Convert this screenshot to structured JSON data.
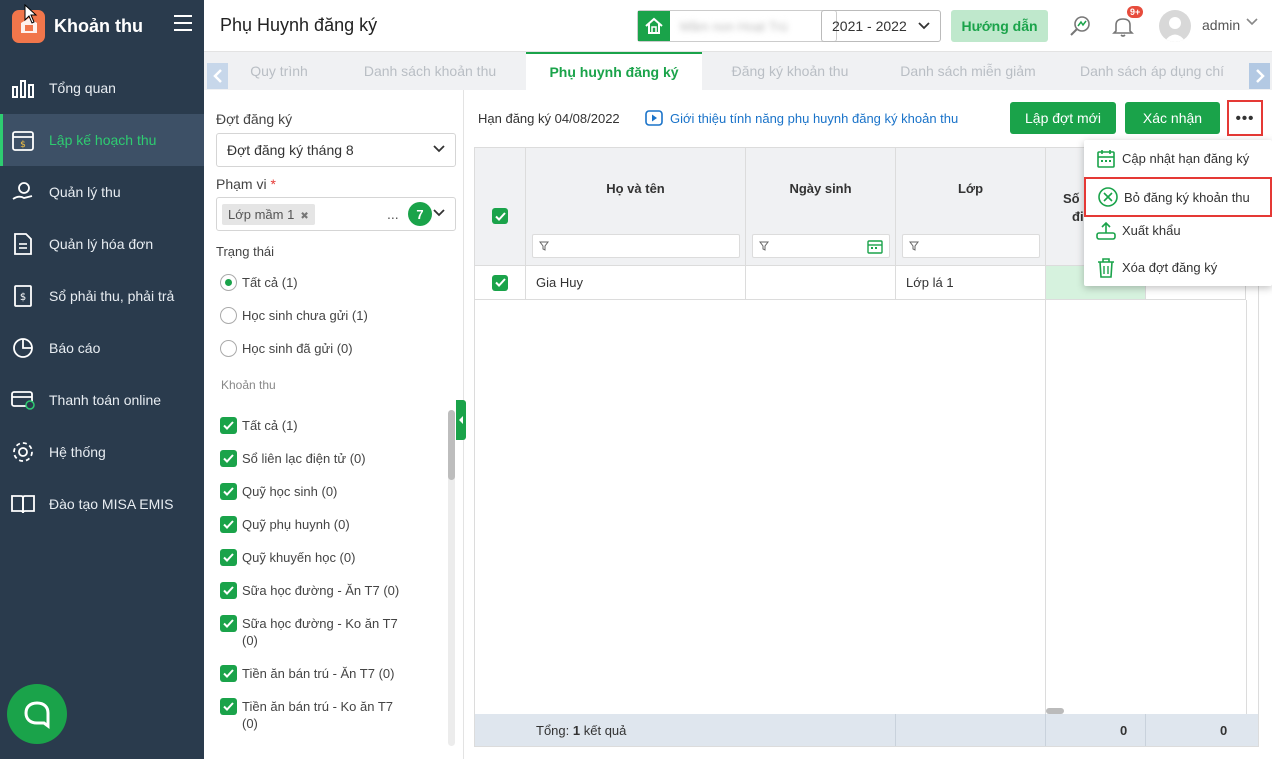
{
  "app": {
    "title": "Khoản thu"
  },
  "sidebar": {
    "items": [
      {
        "label": "Tổng quan",
        "icon": "bar-chart-icon"
      },
      {
        "label": "Lập kế hoạch thu",
        "icon": "calendar-dollar-icon",
        "active": true
      },
      {
        "label": "Quản lý thu",
        "icon": "hand-coin-icon"
      },
      {
        "label": "Quản lý hóa đơn",
        "icon": "invoice-icon"
      },
      {
        "label": "Sổ phải thu, phải trả",
        "icon": "ledger-icon"
      },
      {
        "label": "Báo cáo",
        "icon": "pie-chart-icon"
      },
      {
        "label": "Thanh toán online",
        "icon": "online-payment-icon"
      },
      {
        "label": "Hệ thống",
        "icon": "gear-icon"
      },
      {
        "label": "Đào tạo MISA EMIS",
        "icon": "book-icon"
      }
    ]
  },
  "header": {
    "page_title": "Phụ Huynh đăng ký",
    "school_name": "Mầm non Hoạt Trú",
    "year": "2021 - 2022",
    "guide_label": "Hướng dẫn",
    "notification_badge": "9+",
    "username": "admin"
  },
  "tabs": [
    {
      "label": "Quy trình"
    },
    {
      "label": "Danh sách khoản thu"
    },
    {
      "label": "Phụ huynh đăng ký",
      "active": true
    },
    {
      "label": "Đăng ký khoản thu"
    },
    {
      "label": "Danh sách miễn giảm"
    },
    {
      "label": "Danh sách áp dụng chí"
    }
  ],
  "filter": {
    "period_label": "Đợt đăng ký",
    "period_value": "Đợt đăng ký tháng 8",
    "scope_label": "Phạm vi",
    "scope_required": "*",
    "scope_tag": "Lớp mầm 1",
    "scope_more": "...",
    "scope_count": "7",
    "status_label": "Trạng thái",
    "status_options": [
      {
        "label": "Tất cả (1)",
        "checked": true
      },
      {
        "label": "Học sinh chưa gửi (1)",
        "checked": false
      },
      {
        "label": "Học sinh đã gửi (0)",
        "checked": false
      }
    ],
    "fees_label": "Khoản thu",
    "fees": [
      {
        "label": "Tất cả (1)"
      },
      {
        "label": "Sổ liên lạc điện tử (0)"
      },
      {
        "label": "Quỹ học sinh (0)"
      },
      {
        "label": "Quỹ phụ huynh (0)"
      },
      {
        "label": "Quỹ khuyến học (0)"
      },
      {
        "label": "Sữa học đường - Ăn T7 (0)"
      },
      {
        "label": "Sữa học đường - Ko ăn T7 (0)"
      },
      {
        "label": "Tiền ăn bán trú - Ăn T7 (0)"
      },
      {
        "label": "Tiền ăn bán trú - Ko ăn T7 (0)"
      }
    ]
  },
  "main": {
    "deadline": "Hạn đăng ký 04/08/2022",
    "intro_link": "Giới thiệu tính năng phụ huynh đăng ký khoản thu",
    "new_period_label": "Lập đợt mới",
    "confirm_label": "Xác nhận",
    "more_label": "•••"
  },
  "grid": {
    "columns": [
      "Họ và tên",
      "Ngày sinh",
      "Lớp",
      "Số",
      "đi"
    ],
    "rows": [
      {
        "name": "Gia Huy",
        "dob": "",
        "class": "Lớp lá 1"
      }
    ],
    "footer_label": "Tổng:",
    "footer_count": "1",
    "footer_suffix": "kết quả",
    "footer_val1": "0",
    "footer_val2": "0"
  },
  "menu": {
    "items": [
      {
        "label": "Cập nhật hạn đăng ký",
        "icon": "calendar-icon"
      },
      {
        "label": "Bỏ đăng ký khoản thu",
        "icon": "circle-x-icon",
        "highlighted": true
      },
      {
        "label": "Xuất khẩu",
        "icon": "export-icon"
      },
      {
        "label": "Xóa đợt đăng ký",
        "icon": "trash-icon"
      }
    ]
  },
  "colors": {
    "primary": "#1aa34a",
    "sidebar": "#2a3b4d",
    "highlight": "#e53935",
    "link": "#1a73c9"
  }
}
